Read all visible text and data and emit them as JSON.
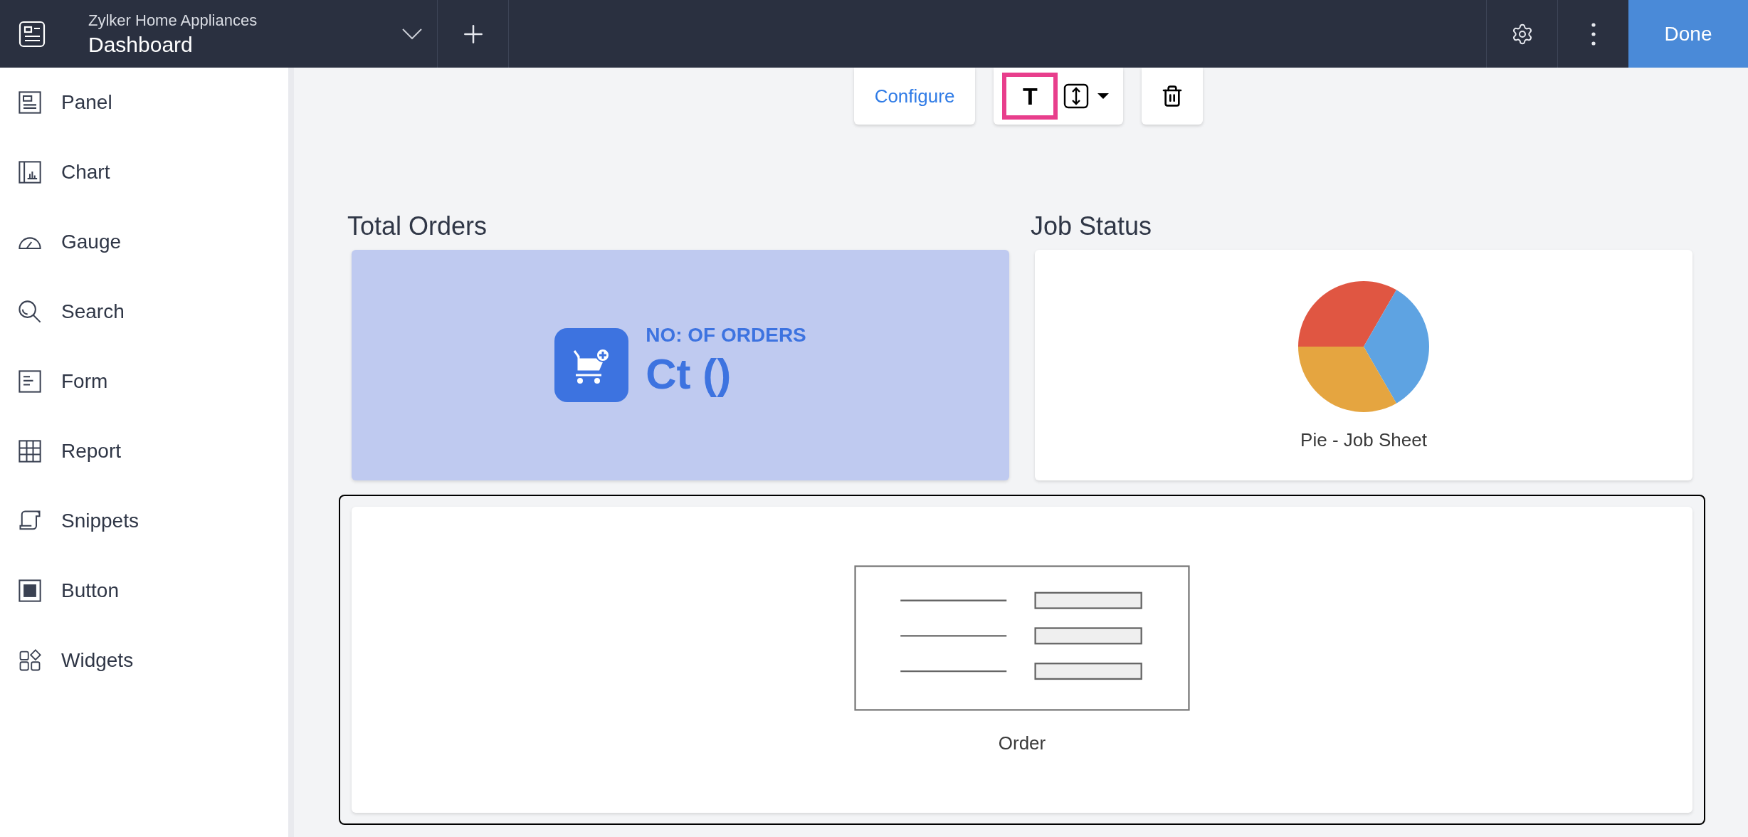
{
  "header": {
    "app_name": "Zylker Home Appliances",
    "page_title": "Dashboard",
    "done_button": "Done"
  },
  "sidebar": {
    "items": [
      {
        "label": "Panel"
      },
      {
        "label": "Chart"
      },
      {
        "label": "Gauge"
      },
      {
        "label": "Search"
      },
      {
        "label": "Form"
      },
      {
        "label": "Report"
      },
      {
        "label": "Snippets"
      },
      {
        "label": "Button"
      },
      {
        "label": "Widgets"
      }
    ]
  },
  "toolbar": {
    "configure_button": "Configure",
    "text_button": {
      "label": "T",
      "selected": true
    }
  },
  "widgets": [
    {
      "kind": "kpi",
      "heading": "Total Orders",
      "label": "NO: OF ORDERS",
      "value": "Ct ()"
    },
    {
      "kind": "pie",
      "heading": "Job Status",
      "caption": "Pie - Job Sheet"
    }
  ],
  "form_widget": {
    "caption": "Order",
    "selected": true
  }
}
